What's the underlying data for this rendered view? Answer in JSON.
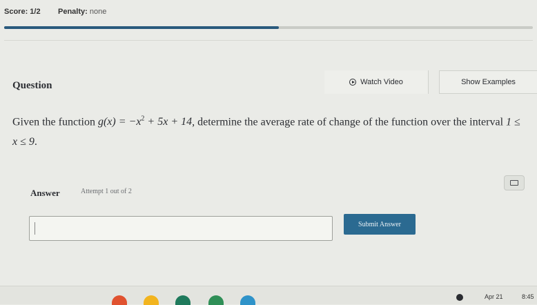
{
  "header": {
    "score_label": "Score: 1/2",
    "penalty_prefix": "Penalty:",
    "penalty_value": "none",
    "progress": 0.52,
    "progress_color": "#2a5a7d"
  },
  "question": {
    "heading": "Question",
    "watch_video_label": "Watch Video",
    "watch_video_icon": "play-circle-icon",
    "show_examples_label": "Show Examples",
    "text_before": "Given the function ",
    "func_lhs": "g(x) = −x",
    "func_exp": "2",
    "func_rhs": " + 5x + 14",
    "text_middle": ", determine the average rate of change of the function over the interval ",
    "interval": "1 ≤ x ≤ 9",
    "text_end": "."
  },
  "answer": {
    "heading": "Answer",
    "attempt_text": "Attempt 1 out of 2",
    "input_value": "",
    "submit_label": "Submit Answer",
    "keyboard_icon": "keyboard-icon",
    "submit_color": "#2b6a91"
  },
  "taskbar": {
    "date": "Apr 21",
    "time": "8:45",
    "dock_colors": [
      "#e0522f",
      "#f2b41e",
      "#1f7a5c",
      "#2f8f57",
      "#2f93c9"
    ]
  }
}
